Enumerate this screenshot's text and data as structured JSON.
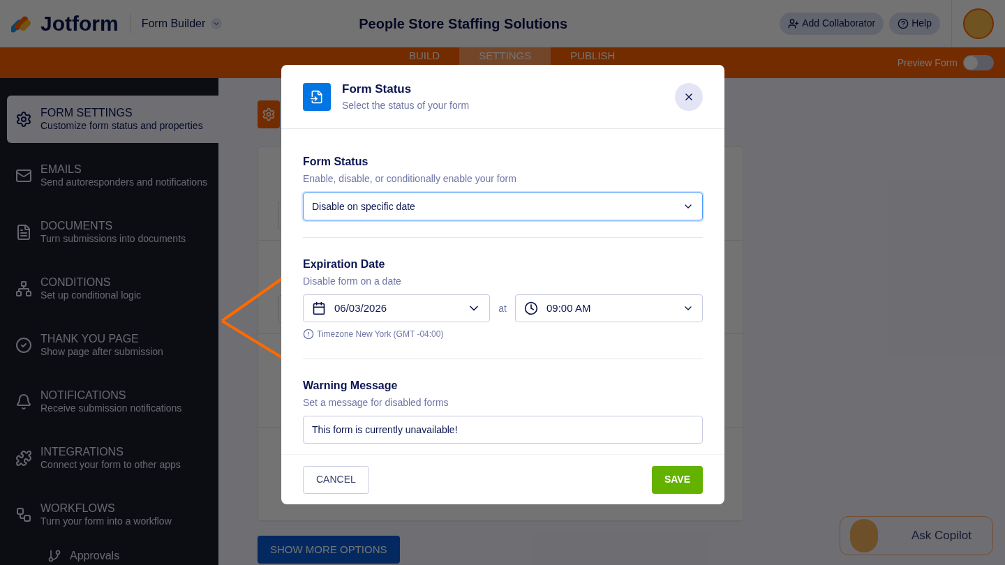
{
  "header": {
    "logo": "Jotform",
    "product": "Form Builder",
    "form_title": "People Store Staffing Solutions",
    "buttons": [
      {
        "label": "Add Collaborator",
        "kind": "collaborator"
      },
      {
        "label": "Help",
        "kind": "help"
      }
    ]
  },
  "nav": {
    "tabs": [
      {
        "label": "BUILD",
        "selected": false
      },
      {
        "label": "SETTINGS",
        "selected": true
      },
      {
        "label": "PUBLISH",
        "selected": false
      }
    ],
    "preview": {
      "label": "Preview Form",
      "on": false
    }
  },
  "sidebar": {
    "items": [
      {
        "title": "FORM SETTINGS",
        "subtitle": "Customize form status and properties",
        "kind": "gear",
        "selected": true
      },
      {
        "title": "EMAILS",
        "subtitle": "Send autoresponders and notifications",
        "kind": "mail",
        "selected": false
      },
      {
        "title": "DOCUMENTS",
        "subtitle": "Turn submissions into documents",
        "kind": "document",
        "selected": false
      },
      {
        "title": "CONDITIONS",
        "subtitle": "Set up conditional logic",
        "kind": "conditions",
        "selected": false
      },
      {
        "title": "THANK YOU PAGE",
        "subtitle": "Show page after submission",
        "kind": "check",
        "selected": false
      },
      {
        "title": "NOTIFICATIONS",
        "subtitle": "Receive submission notifications",
        "kind": "bell",
        "selected": false
      },
      {
        "title": "INTEGRATIONS",
        "subtitle": "Connect your form to other apps",
        "kind": "puzzle",
        "selected": false
      },
      {
        "title": "WORKFLOWS",
        "subtitle": "Turn your form into a workflow",
        "kind": "workflow",
        "selected": false,
        "children": [
          {
            "title": "Approvals",
            "kind": "approvals",
            "selected": false
          }
        ]
      }
    ]
  },
  "content": {
    "more_button": "SHOW MORE OPTIONS"
  },
  "modal": {
    "title": "Form Status",
    "subtitle": "Select the status of your form",
    "status": {
      "label": "Form Status",
      "hint": "Enable, disable, or conditionally enable your form",
      "value": "Disable on specific date"
    },
    "expiration": {
      "label": "Expiration Date",
      "hint": "Disable form on a date",
      "date": "06/03/2026",
      "at": "at",
      "time": "09:00 AM",
      "timezone": "Timezone New York (GMT -04:00)"
    },
    "warning": {
      "label": "Warning Message",
      "hint": "Set a message for disabled forms",
      "value": "This form is currently unavailable!"
    },
    "cancel": "CANCEL",
    "save": "SAVE"
  },
  "copilot": {
    "label": "Ask Copilot"
  }
}
